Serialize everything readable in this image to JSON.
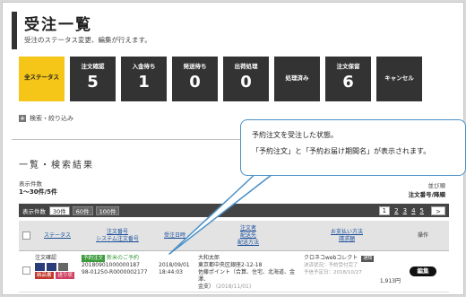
{
  "page": {
    "title": "受注一覧",
    "description": "受注のステータス変更、編集が行えます。"
  },
  "status_tiles": [
    {
      "label": "全ステータス",
      "count": ""
    },
    {
      "label": "注文確認",
      "count": "5"
    },
    {
      "label": "入金待ち",
      "count": "1"
    },
    {
      "label": "発送待ち",
      "count": "0"
    },
    {
      "label": "出荷処理",
      "count": "0"
    },
    {
      "label": "処理済み",
      "count": ""
    },
    {
      "label": "注文保留",
      "count": "6"
    },
    {
      "label": "キャンセル",
      "count": ""
    }
  ],
  "filter": {
    "label": "検索・絞り込み",
    "icon": "plus-icon"
  },
  "list": {
    "section_title": "一覧・検索結果",
    "count_label": "表示件数",
    "count_value": "1～30件/5件",
    "sort_label": "並び順",
    "sort_value": "注文番号/降順"
  },
  "pager": {
    "per_page_label": "表示件数",
    "per_page_options": [
      "30件",
      "60件",
      "100件"
    ],
    "selected_per_page": "30件",
    "pages": [
      "1",
      "2",
      "3",
      "4",
      "5"
    ],
    "current_page": "1",
    "next_icon": "chevron-right-icon"
  },
  "table": {
    "headers": {
      "status": "ステータス",
      "order_no_1": "注文番号",
      "order_no_2": "システム注文番号",
      "order_date": "受注日時",
      "ship_1": "注文者",
      "ship_2": "配送先",
      "ship_3": "配送方法",
      "pay_1": "お支払い方法",
      "pay_2": "請求額",
      "action": "操作"
    },
    "rows": [
      {
        "status": "注文確認",
        "tags": [
          "納品書",
          "送り状"
        ],
        "preorder_badge": "予約注文",
        "preorder_text": "新米のご予約",
        "order_no": "20180901000000187",
        "system_no": "98-01250-R0000002177",
        "date": "2018/09/01",
        "time": "18:44:03",
        "customer": "大和太郎",
        "address": "東京都中央区銀座2-12-18",
        "points": "佐藤ポイント（合算、住宅、北海道、金澤、",
        "points_2": "金支）",
        "points_date": "(2018/11/01)",
        "payment": "クロネコwebコレクト",
        "delivery_badge": "通知",
        "payment_status": "決済状況：予約受付完了",
        "payment_date": "予信予定日：2018/10/27",
        "amount": "1,913円",
        "edit": "編集"
      }
    ]
  },
  "callout": {
    "line1": "予約注文を受注した状態。",
    "line2": "「予約注文」と「予約お届け期間名」が表示されます。"
  },
  "colors": {
    "accent_yellow": "#f5c518",
    "tile_dark": "#333333",
    "link_blue": "#1a4f9c",
    "badge_green": "#3a9a3a",
    "callout_border": "#4a90c8"
  }
}
